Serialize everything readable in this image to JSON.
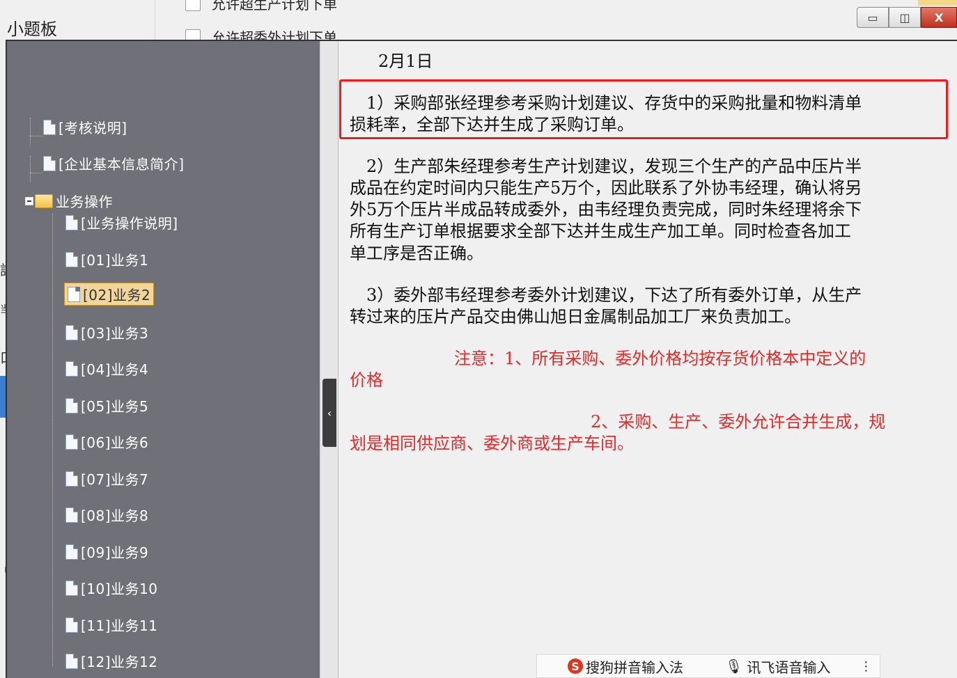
{
  "window": {
    "title": "小题板",
    "buttons": {
      "minimize": "▭",
      "maximize": "◫",
      "close": "X"
    }
  },
  "background": {
    "checkbox_labels": [
      "允许超生产计划下单",
      "允许超委外计划下单"
    ],
    "side_chars": [
      "詳",
      "当",
      "口",
      "夕",
      "刂"
    ]
  },
  "tree": {
    "items": [
      {
        "label": "[考核说明]",
        "type": "doc"
      },
      {
        "label": "[企业基本信息简介]",
        "type": "doc"
      },
      {
        "label": "业务操作",
        "type": "folder"
      },
      {
        "label": "[业务操作说明]",
        "type": "doc"
      },
      {
        "label": "[01]业务1",
        "type": "doc"
      },
      {
        "label": "[02]业务2",
        "type": "doc",
        "selected": true
      },
      {
        "label": "[03]业务3",
        "type": "doc"
      },
      {
        "label": "[04]业务4",
        "type": "doc"
      },
      {
        "label": "[05]业务5",
        "type": "doc"
      },
      {
        "label": "[06]业务6",
        "type": "doc"
      },
      {
        "label": "[07]业务7",
        "type": "doc"
      },
      {
        "label": "[08]业务8",
        "type": "doc"
      },
      {
        "label": "[09]业务9",
        "type": "doc"
      },
      {
        "label": "[10]业务10",
        "type": "doc"
      },
      {
        "label": "[11]业务11",
        "type": "doc"
      },
      {
        "label": "[12]业务12",
        "type": "doc"
      }
    ]
  },
  "splitter": {
    "glyph": "‹"
  },
  "content": {
    "date": "2月1日",
    "para1_line1": "1）采购部张经理参考采购计划建议、存货中的采购批量和物料清单",
    "para1_line2": "损耗率，全部下达并生成了采购订单。",
    "para2_line1": "2）生产部朱经理参考生产计划建议，发现三个生产的产品中压片半",
    "para2_line2": "成品在约定时间内只能生产5万个，因此联系了外协韦经理，确认将另",
    "para2_line3": "外5万个压片半成品转成委外，由韦经理负责完成，同时朱经理将余下",
    "para2_line4": "所有生产订单根据要求全部下达并生成生产加工单。同时检查各加工",
    "para2_line5": "单工序是否正确。",
    "para3_line1": "3）委外部韦经理参考委外计划建议，下达了所有委外订单，从生产",
    "para3_line2": "转过来的压片产品交由佛山旭日金属制品加工厂来负责加工。",
    "note1_line1": "注意：1、所有采购、委外价格均按存货价格本中定义的",
    "note1_line2": "价格",
    "note2_line1": "2、采购、生产、委外允许合并生成，规",
    "note2_line2": "划是相同供应商、委外商或生产车间。"
  },
  "ime": {
    "logo": "S",
    "sogou_label": "搜狗拼音输入法",
    "mic": "🎙",
    "xunfei_label": "讯飞语音输入",
    "more": "⋮"
  },
  "colors": {
    "tree_bg": "#707078",
    "highlight_border": "#ee1c1c",
    "note_red": "#e52a2a",
    "selected_bg": "#f1d59b"
  }
}
